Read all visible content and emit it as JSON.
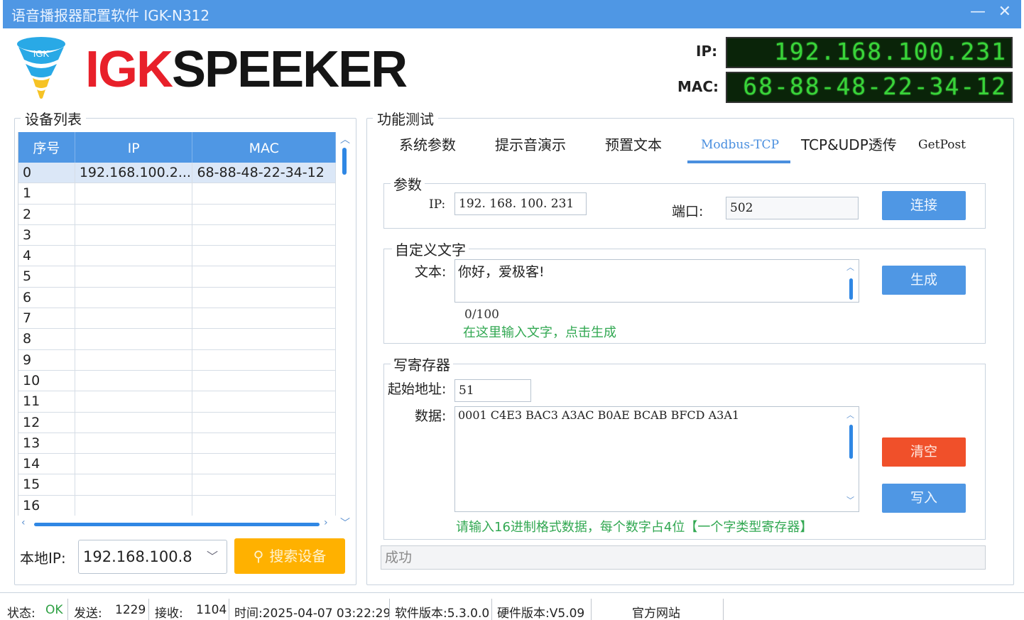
{
  "window": {
    "title": "语音播报器配置软件 IGK-N312",
    "minimize_glyph": "—",
    "close_glyph": "✕"
  },
  "header": {
    "logo_badge": "IGK",
    "brand_part1": "IGK",
    "brand_part2": "SPEEKER",
    "ip_label": "IP:",
    "ip_value": "192.168.100.231",
    "mac_label": "MAC:",
    "mac_value": "68-88-48-22-34-12"
  },
  "device_list": {
    "legend": "设备列表",
    "columns": [
      "序号",
      "IP",
      "MAC"
    ],
    "rows": [
      [
        "0",
        "192.168.100.2...",
        "68-88-48-22-34-12"
      ],
      [
        "1",
        "",
        ""
      ],
      [
        "2",
        "",
        ""
      ],
      [
        "3",
        "",
        ""
      ],
      [
        "4",
        "",
        ""
      ],
      [
        "5",
        "",
        ""
      ],
      [
        "6",
        "",
        ""
      ],
      [
        "7",
        "",
        ""
      ],
      [
        "8",
        "",
        ""
      ],
      [
        "9",
        "",
        ""
      ],
      [
        "10",
        "",
        ""
      ],
      [
        "11",
        "",
        ""
      ],
      [
        "12",
        "",
        ""
      ],
      [
        "13",
        "",
        ""
      ],
      [
        "14",
        "",
        ""
      ],
      [
        "15",
        "",
        ""
      ],
      [
        "16",
        "",
        ""
      ]
    ],
    "local_ip_label": "本地IP:",
    "local_ip_value": "192.168.100.8",
    "search_button": "搜索设备"
  },
  "function_test": {
    "legend": "功能测试",
    "tabs": [
      "系统参数",
      "提示音演示",
      "预置文本",
      "Modbus-TCP",
      "TCP&UDP透传",
      "GetPost"
    ],
    "active_tab": "Modbus-TCP",
    "params": {
      "legend": "参数",
      "ip_label": "IP:",
      "ip_value": "192. 168. 100. 231",
      "port_label": "端口:",
      "port_value": "502",
      "connect_button": "连接"
    },
    "custom_text": {
      "legend": "自定义文字",
      "text_label": "文本:",
      "text_value": "你好，爱极客!",
      "count": "0/100",
      "hint": "在这里输入文字，点击生成",
      "generate_button": "生成"
    },
    "write_register": {
      "legend": "写寄存器",
      "start_label": "起始地址:",
      "start_value": "51",
      "data_label": "数据:",
      "data_value": "0001 C4E3 BAC3 A3AC B0AE BCAB BFCD A3A1",
      "hint": "请输入16进制格式数据，每个数字占4位【一个字类型寄存器】",
      "clear_button": "清空",
      "write_button": "写入"
    },
    "status_text": "成功"
  },
  "statusbar": {
    "state_label": "状态:",
    "state_value": "OK",
    "send_label": "发送:",
    "send_value": "1229",
    "recv_label": "接收:",
    "recv_value": "1104",
    "time": "时间:2025-04-07 03:22:29",
    "software_version": "软件版本:5.3.0.0",
    "hardware_version": "硬件版本:V5.09",
    "website": "官方网站"
  },
  "colors": {
    "accent": "#4f97e4",
    "brand_red": "#e8202a",
    "led_green": "#39d439",
    "search_orange": "#ffb100",
    "clear_red": "#f0502a",
    "hint_green": "#32a852"
  }
}
